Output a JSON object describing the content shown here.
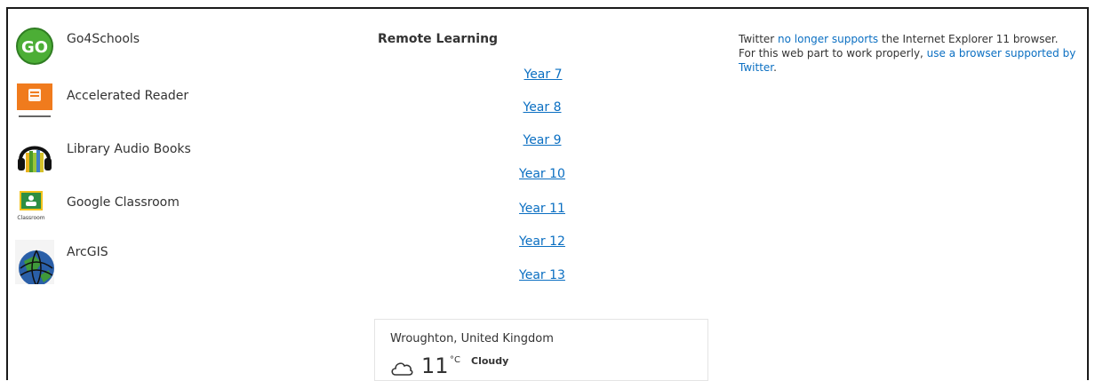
{
  "links": [
    {
      "label": "Go4Schools",
      "icon": "go4schools-logo-icon"
    },
    {
      "label": "Accelerated Reader",
      "icon": "accelerated-reader-logo-icon"
    },
    {
      "label": "Library Audio Books",
      "icon": "headphones-books-icon"
    },
    {
      "label": "Google Classroom",
      "icon": "google-classroom-logo-icon",
      "icon_text": "Classroom"
    },
    {
      "label": "ArcGIS",
      "icon": "globe-icon"
    }
  ],
  "remote": {
    "title": "Remote Learning",
    "years": [
      "Year 7",
      "Year 8",
      "Year 9",
      "Year 10",
      "Year 11",
      "Year 12",
      "Year 13"
    ]
  },
  "twitter": {
    "pre": "Twitter ",
    "link1": "no longer supports",
    "mid": " the Internet Explorer 11 browser. For this web part to work properly, ",
    "link2": "use a browser supported by Twitter",
    "post": "."
  },
  "weather": {
    "location": "Wroughton, United Kingdom",
    "temp": "11",
    "unit": "°C",
    "condition": "Cloudy"
  },
  "colors": {
    "link": "#0b6fc2",
    "go_green": "#4cae36",
    "ar_orange": "#f07b1d",
    "classroom_green": "#2d8f43"
  }
}
